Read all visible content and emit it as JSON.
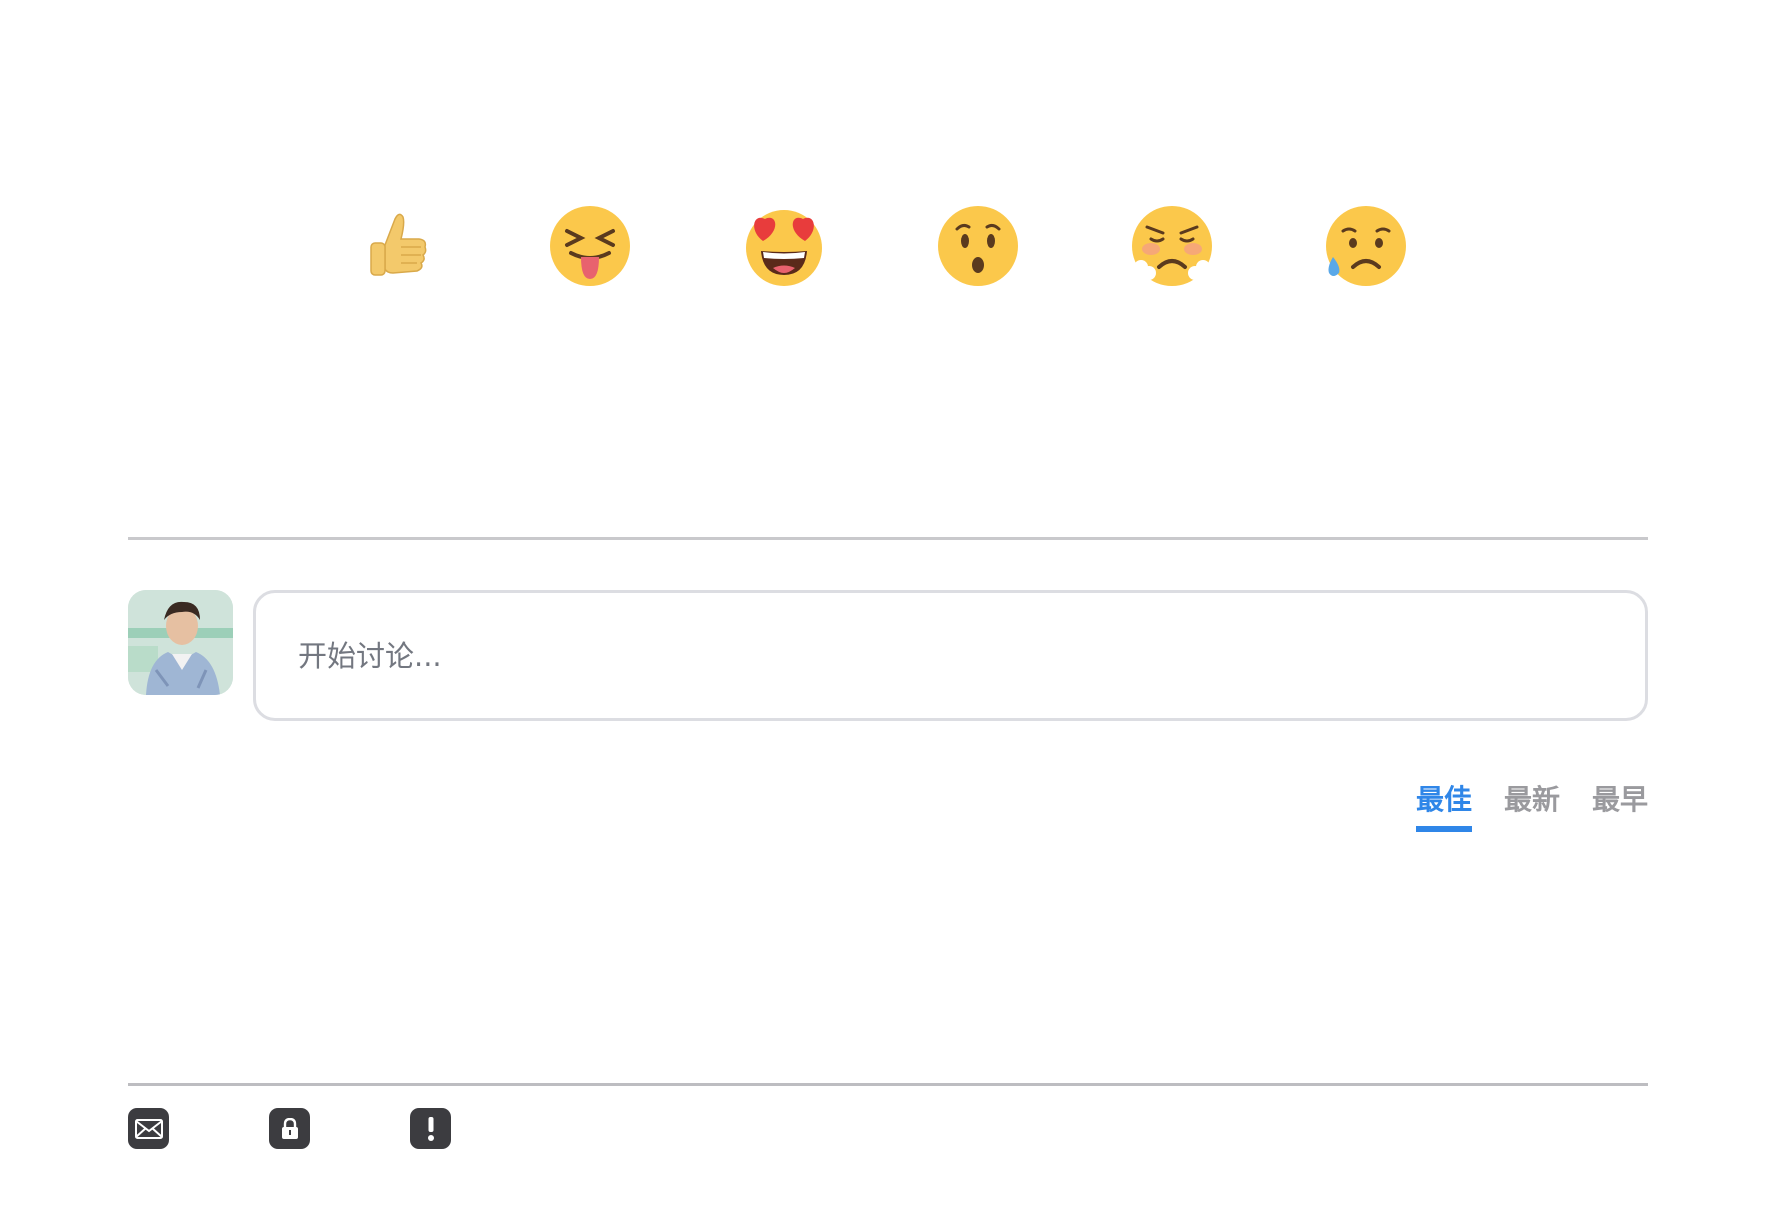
{
  "reactions": [
    {
      "name": "thumbs-up"
    },
    {
      "name": "squinting-tongue"
    },
    {
      "name": "heart-eyes"
    },
    {
      "name": "surprised"
    },
    {
      "name": "angry-steam"
    },
    {
      "name": "sad-sweat"
    }
  ],
  "comment": {
    "placeholder": "开始讨论..."
  },
  "sort": {
    "tabs": [
      {
        "label": "最佳",
        "active": true
      },
      {
        "label": "最新",
        "active": false
      },
      {
        "label": "最早",
        "active": false
      }
    ]
  },
  "footer": {
    "icons": [
      "mail-icon",
      "lock-icon",
      "exclamation-icon"
    ]
  },
  "colors": {
    "accent": "#2f86e8",
    "emoji_face": "#fbc84b",
    "icon_bg": "#3c3c40"
  }
}
